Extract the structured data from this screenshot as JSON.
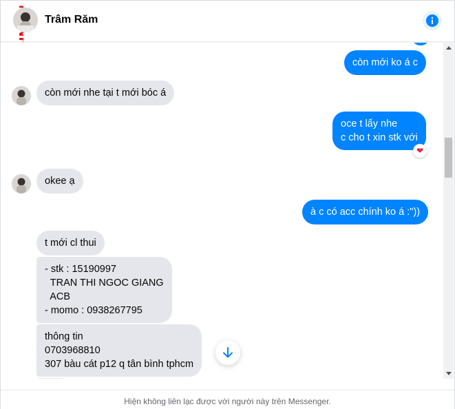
{
  "header": {
    "contact_name": "Trâm Răm",
    "watermark": "M.INFO"
  },
  "messages": [
    {
      "from": "me",
      "text": "còn mới ko á c"
    },
    {
      "from": "them",
      "text": "còn mới nhe tại t mới bóc á"
    },
    {
      "from": "me",
      "text": "oce t lấy nhe\nc cho t xin stk với",
      "reaction": "heart"
    },
    {
      "from": "them",
      "text": "okee ạ"
    },
    {
      "from": "me",
      "text": "à c có acc chính ko á :\"))"
    },
    {
      "from": "them",
      "text": "t mới cl thui"
    },
    {
      "from": "them",
      "text": "- stk : 15190997\n  TRAN THI NGOC GIANG\n  ACB\n- momo : 0938267795"
    },
    {
      "from": "them",
      "text": "thông tin\n0703968810\n307 bàu cát p12 q tân bình tphcm"
    }
  ],
  "footer": {
    "notice": "Hiện không liên lạc được với người này trên Messenger."
  },
  "colors": {
    "outgoing": "#0084ff",
    "incoming": "#e4e6eb",
    "reaction": "#e41e3f"
  }
}
